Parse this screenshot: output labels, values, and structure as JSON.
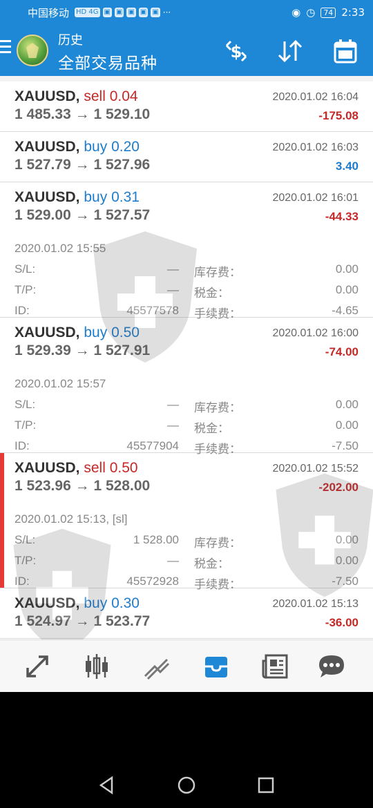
{
  "status_bar": {
    "carrier": "中国移动",
    "network": "HD 4G",
    "battery": "74",
    "time": "2:33",
    "more": "···"
  },
  "header": {
    "title_top": "历史",
    "title_main": "全部交易品种"
  },
  "labels": {
    "sl": "S/L:",
    "tp": "T/P:",
    "id": "ID:",
    "swap": "库存费：",
    "tax": "税金：",
    "fee": "手续费："
  },
  "trades": [
    {
      "symbol": "XAUUSD,",
      "side": "sell",
      "volume": "0.04",
      "price_open": "1 485.33",
      "arrow": "→",
      "price_close": "1 529.10",
      "close_time": "2020.01.02 16:04",
      "profit": "-175.08"
    },
    {
      "symbol": "XAUUSD,",
      "side": "buy",
      "volume": "0.20",
      "price_open": "1 527.79",
      "arrow": "→",
      "price_close": "1 527.96",
      "close_time": "2020.01.02 16:03",
      "profit": "3.40"
    },
    {
      "symbol": "XAUUSD,",
      "side": "buy",
      "volume": "0.31",
      "price_open": "1 529.00",
      "arrow": "→",
      "price_close": "1 527.57",
      "close_time": "2020.01.02 16:01",
      "profit": "-44.33",
      "open_time": "2020.01.02 15:55",
      "sl": "—",
      "tp": "—",
      "id": "45577578",
      "swap": "0.00",
      "tax": "0.00",
      "fee": "-4.65"
    },
    {
      "symbol": "XAUUSD,",
      "side": "buy",
      "volume": "0.50",
      "price_open": "1 529.39",
      "arrow": "→",
      "price_close": "1 527.91",
      "close_time": "2020.01.02 16:00",
      "profit": "-74.00",
      "open_time": "2020.01.02 15:57",
      "sl": "—",
      "tp": "—",
      "id": "45577904",
      "swap": "0.00",
      "tax": "0.00",
      "fee": "-7.50"
    },
    {
      "symbol": "XAUUSD,",
      "side": "sell",
      "volume": "0.50",
      "price_open": "1 523.96",
      "arrow": "→",
      "price_close": "1 528.00",
      "close_time": "2020.01.02 15:52",
      "profit": "-202.00",
      "open_time": "2020.01.02 15:13, [sl]",
      "sl": "1 528.00",
      "tp": "—",
      "id": "45572928",
      "swap": "0.00",
      "tax": "0.00",
      "fee": "-7.50"
    },
    {
      "symbol": "XAUUSD,",
      "side": "buy",
      "volume": "0.30",
      "price_open": "1 524.97",
      "arrow": "→",
      "price_close": "1 523.77",
      "close_time": "2020.01.02 15:13",
      "profit": "-36.00"
    }
  ],
  "bottom_nav": [
    "quotes-icon",
    "chart-icon",
    "trade-icon",
    "history-icon",
    "news-icon",
    "chat-icon"
  ],
  "colors": {
    "accent": "#1e88d6",
    "sell": "#c62828",
    "buy": "#1e7ccc",
    "selected_bar": "#e53935"
  }
}
